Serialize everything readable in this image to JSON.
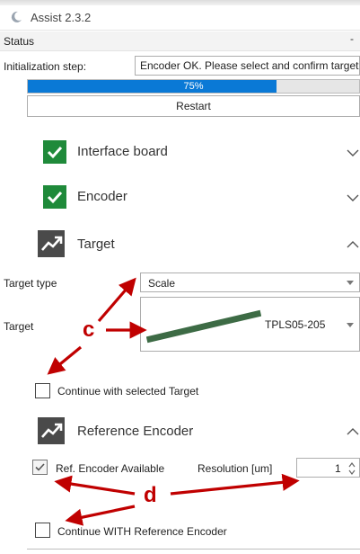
{
  "window": {
    "title": "Assist 2.3.2"
  },
  "status": {
    "label": "Status",
    "pin_glyph": "-"
  },
  "init": {
    "label": "Initialization step:",
    "value": "Encoder OK. Please select and confirm target"
  },
  "progress": {
    "percent": 75,
    "text": "75%"
  },
  "restart": {
    "label": "Restart"
  },
  "sections": {
    "interface_board": {
      "title": "Interface board",
      "state": "ok",
      "expanded": false
    },
    "encoder": {
      "title": "Encoder",
      "state": "ok",
      "expanded": false
    },
    "target": {
      "title": "Target",
      "expanded": true
    },
    "reference_encoder": {
      "title": "Reference Encoder",
      "expanded": true
    }
  },
  "target": {
    "type_label": "Target type",
    "type_value": "Scale",
    "target_label": "Target",
    "target_value": "TPLS05-205",
    "continue_label": "Continue with selected Target",
    "continue_checked": false
  },
  "reference": {
    "available_label": "Ref. Encoder Available",
    "available_checked": true,
    "resolution_label": "Resolution [um]",
    "resolution_value": "1",
    "continue_label": "Continue WITH Reference Encoder",
    "continue_checked": false
  },
  "annotations": {
    "c": "c",
    "d": "d"
  },
  "colors": {
    "accent_blue": "#0a79d6",
    "ok_green": "#1f8a3a",
    "badge_dark": "#4a4a4a",
    "annotation_red": "#c00000",
    "scale_green": "#3d6b45"
  },
  "icons": {
    "app": "crescent-icon",
    "ok": "check-icon",
    "section": "trend-icon",
    "collapse": "chevron-down-icon",
    "expand": "chevron-up-icon"
  }
}
